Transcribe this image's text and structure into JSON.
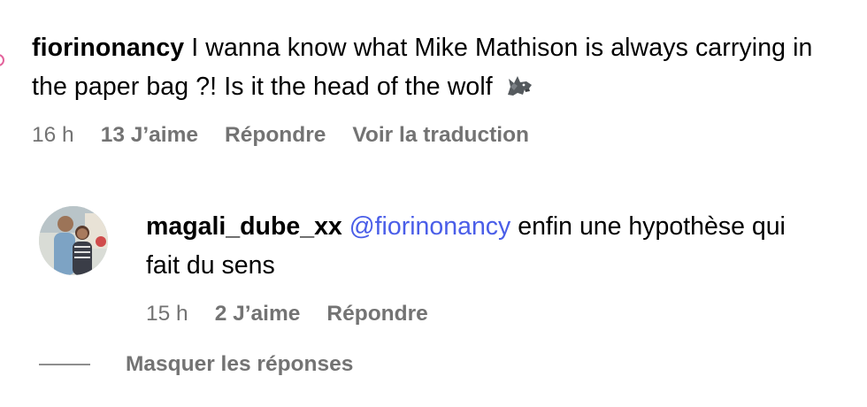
{
  "comment": {
    "username": "fiorinonancy",
    "text": "I wanna know what Mike Mathison is always carrying in the paper bag ?! Is it the head of the wolf",
    "emoji_icon": "wolf-icon",
    "time": "16 h",
    "likes": "13 J’aime",
    "reply_label": "Répondre",
    "translate_label": "Voir la traduction"
  },
  "reply": {
    "username": "magali_dube_xx",
    "mention": "@fiorinonancy",
    "text": "enfin une hypothèse qui fait du sens",
    "time": "15 h",
    "likes": "2 J’aime",
    "reply_label": "Répondre"
  },
  "hide_replies_label": "Masquer les réponses",
  "colors": {
    "meta_text": "#737373",
    "mention": "#4a5ee8",
    "avatar_ring": "#e3629b"
  }
}
